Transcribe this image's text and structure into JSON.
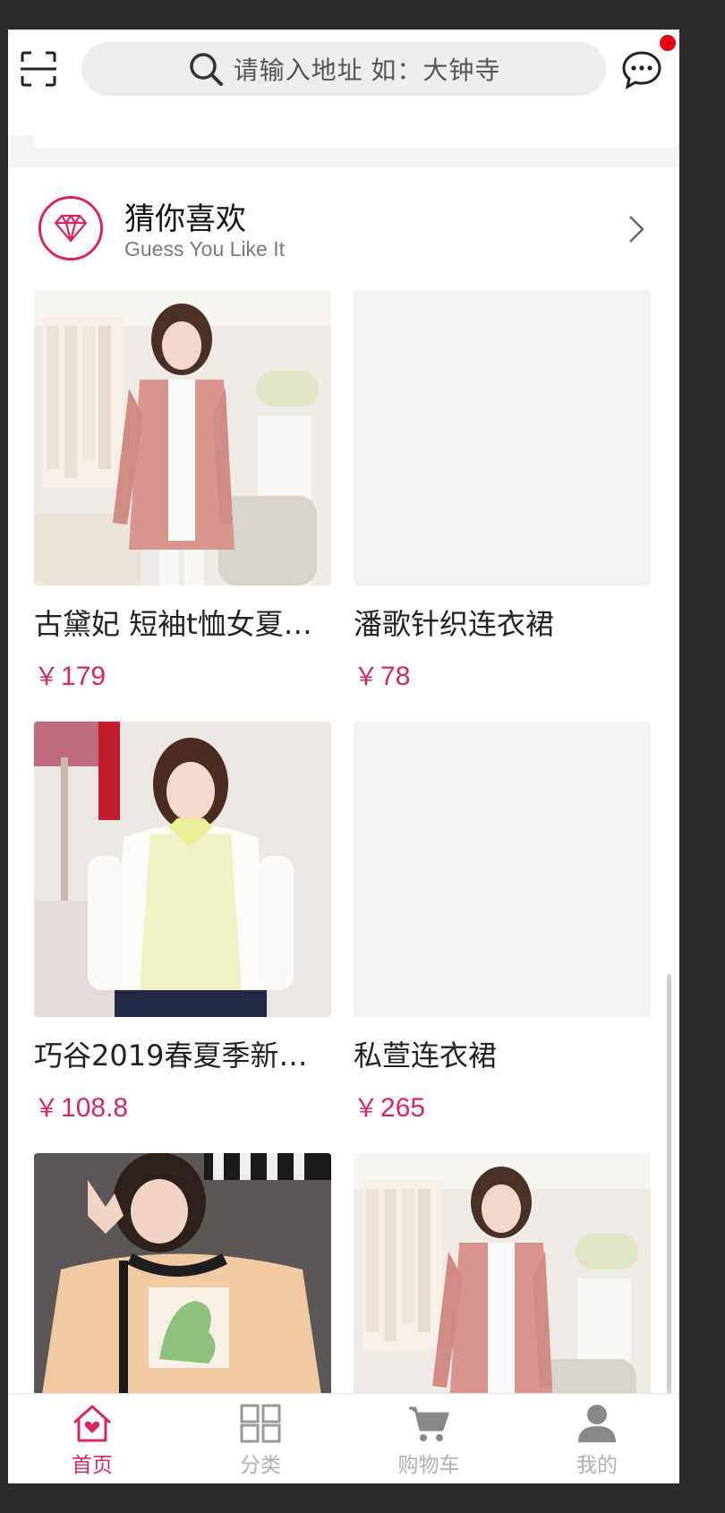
{
  "header": {
    "search_placeholder": "请输入地址 如：大钟寺",
    "has_unread": true,
    "icons": [
      "scan-icon",
      "search-icon",
      "message-icon"
    ]
  },
  "section": {
    "title": "猜你喜欢",
    "subtitle": "Guess You Like It",
    "icon": "diamond-icon"
  },
  "products": [
    {
      "title": "古黛妃 短袖t恤女夏…",
      "price": "179",
      "currency": "￥",
      "image": "pink-coat"
    },
    {
      "title": "潘歌针织连衣裙",
      "price": "78",
      "currency": "￥",
      "image": "placeholder"
    },
    {
      "title": "巧谷2019春夏季新品…",
      "price": "108.8",
      "currency": "￥",
      "image": "lace-blouse"
    },
    {
      "title": "私萱连衣裙",
      "price": "265",
      "currency": "￥",
      "image": "placeholder"
    },
    {
      "title": "",
      "price": "",
      "currency": "",
      "image": "dino-tee"
    },
    {
      "title": "",
      "price": "",
      "currency": "",
      "image": "pink-coat"
    }
  ],
  "tabbar": {
    "items": [
      {
        "label": "首页",
        "icon": "home-icon",
        "active": true
      },
      {
        "label": "分类",
        "icon": "category-icon",
        "active": false
      },
      {
        "label": "购物车",
        "icon": "cart-icon",
        "active": false
      },
      {
        "label": "我的",
        "icon": "profile-icon",
        "active": false
      }
    ]
  },
  "colors": {
    "accent": "#d6285e",
    "badge": "#e60012"
  }
}
